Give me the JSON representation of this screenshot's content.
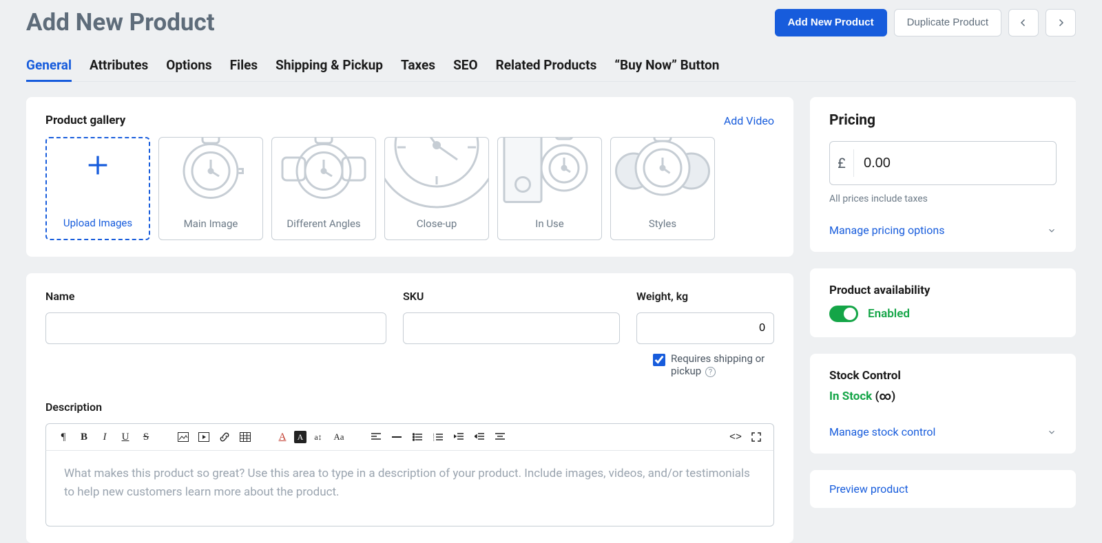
{
  "header": {
    "title": "Add New Product",
    "primary_button": "Add New Product",
    "secondary_button": "Duplicate Product"
  },
  "tabs": [
    {
      "label": "General",
      "active": true
    },
    {
      "label": "Attributes",
      "active": false
    },
    {
      "label": "Options",
      "active": false
    },
    {
      "label": "Files",
      "active": false
    },
    {
      "label": "Shipping & Pickup",
      "active": false
    },
    {
      "label": "Taxes",
      "active": false
    },
    {
      "label": "SEO",
      "active": false
    },
    {
      "label": "Related Products",
      "active": false
    },
    {
      "label": "“Buy Now” Button",
      "active": false
    }
  ],
  "gallery": {
    "title": "Product gallery",
    "add_video": "Add Video",
    "upload_label": "Upload Images",
    "thumbs": [
      {
        "label": "Main Image"
      },
      {
        "label": "Different Angles"
      },
      {
        "label": "Close-up"
      },
      {
        "label": "In Use"
      },
      {
        "label": "Styles"
      }
    ]
  },
  "fields": {
    "name_label": "Name",
    "sku_label": "SKU",
    "weight_label": "Weight, kg",
    "weight_value": "0",
    "requires_shipping": "Requires shipping or pickup",
    "description_label": "Description",
    "description_placeholder": "What makes this product so great? Use this area to type in a description of your product. Include images, videos, and/or testimonials to help new customers learn more about the product."
  },
  "pricing": {
    "title": "Pricing",
    "currency": "£",
    "value": "0.00",
    "note": "All prices include taxes",
    "expand": "Manage pricing options"
  },
  "availability": {
    "title": "Product availability",
    "enabled": "Enabled"
  },
  "stock": {
    "title": "Stock Control",
    "status_prefix": "In Stock",
    "status_suffix": "(∞)",
    "expand": "Manage stock control"
  },
  "preview": {
    "link": "Preview product"
  }
}
